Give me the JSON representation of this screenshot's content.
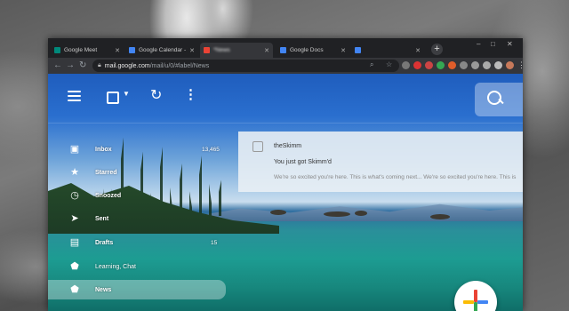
{
  "browser": {
    "tabs": [
      {
        "title": "Google Meet",
        "color": "#00897b"
      },
      {
        "title": "Google Calendar - W",
        "color": "#4285f4"
      },
      {
        "title": "*News",
        "color": "#ea4335"
      },
      {
        "title": "Google Docs",
        "color": "#4285f4"
      },
      {
        "title": "",
        "color": "#4285f4"
      }
    ],
    "url_host": "mail.google.com",
    "url_path": "/mail/u/0/#label/News",
    "window_controls": {
      "minimize": "–",
      "maximize": "□",
      "close": "✕"
    }
  },
  "gmail": {
    "toolbar_icons": [
      "menu-icon",
      "select-checkbox",
      "refresh-icon",
      "more-vert-icon",
      "search-icon"
    ],
    "nav": [
      {
        "label": "Inbox",
        "count": "13,465",
        "icon": "inbox-icon"
      },
      {
        "label": "Starred",
        "count": "",
        "icon": "star-icon"
      },
      {
        "label": "Snoozed",
        "count": "",
        "icon": "clock-icon"
      },
      {
        "label": "Sent",
        "count": "",
        "icon": "send-icon"
      },
      {
        "label": "Drafts",
        "count": "15",
        "icon": "draft-icon"
      },
      {
        "label": "Learning, Chat",
        "count": "",
        "icon": "label-icon"
      },
      {
        "label": "News",
        "count": "",
        "icon": "label-icon"
      }
    ],
    "email": {
      "from": "theSkimm",
      "subject": "You just got Skimm'd",
      "snippet": "We're so excited you're here. This is what's coming next... We're so excited you're here. This is"
    },
    "compose_icon": "compose-plus-icon"
  }
}
